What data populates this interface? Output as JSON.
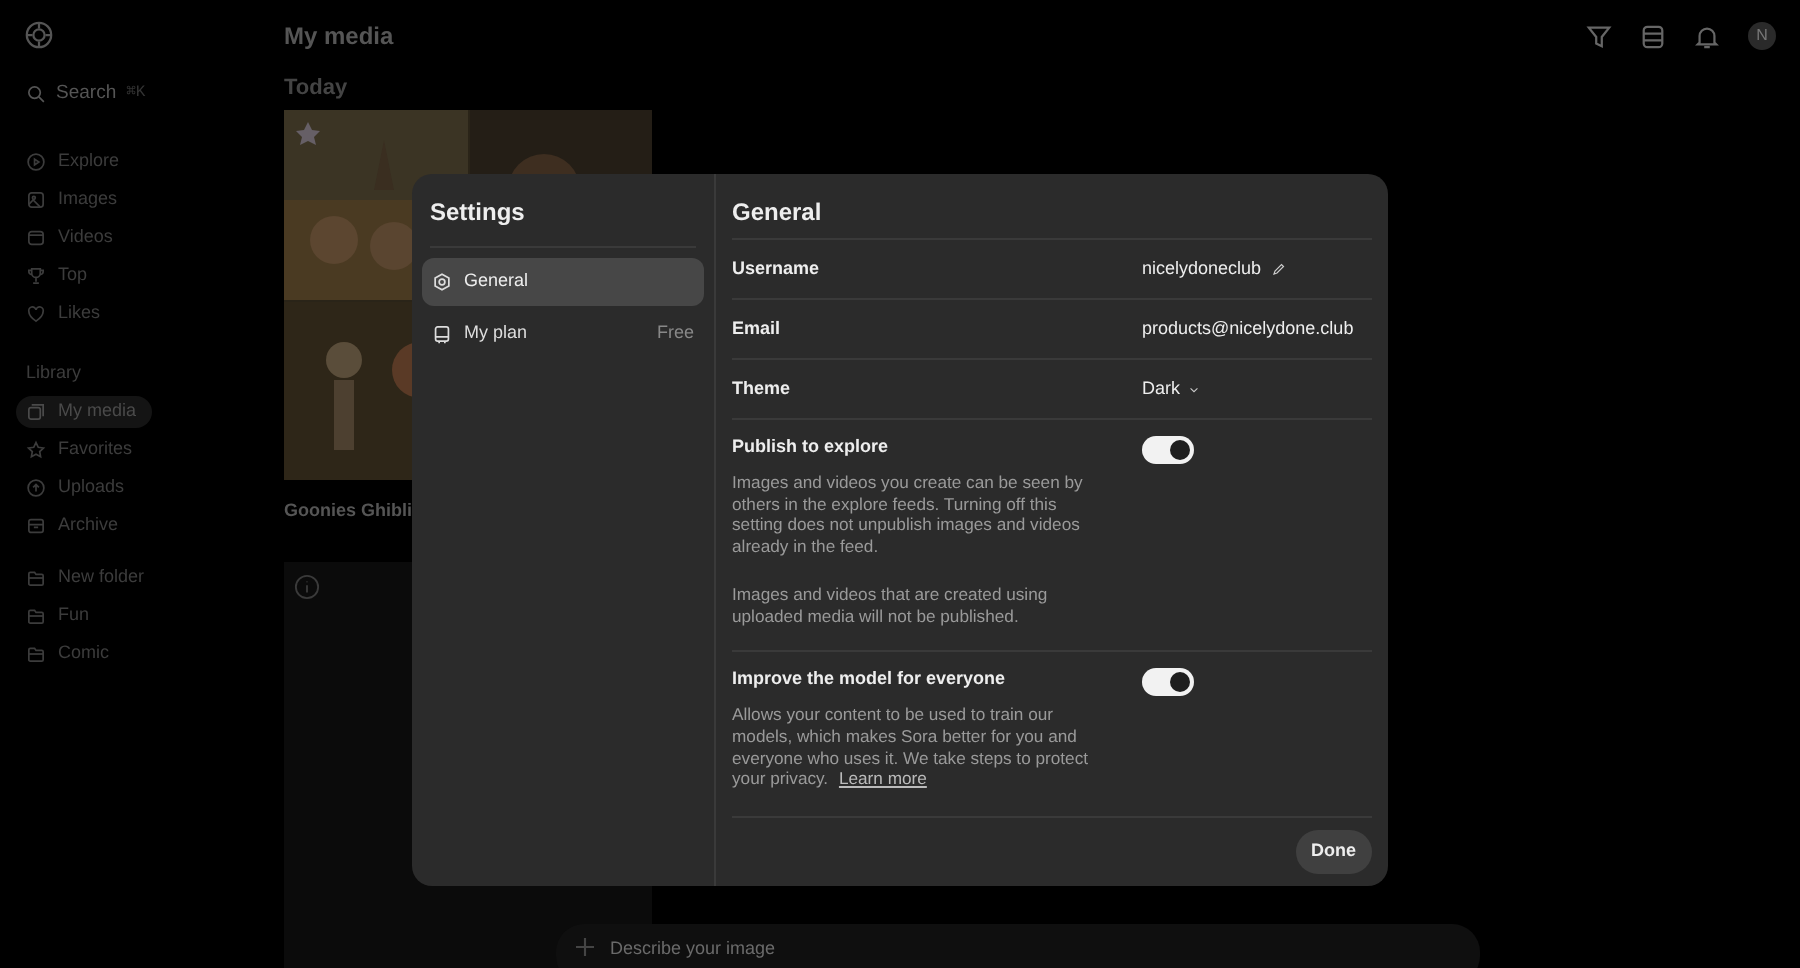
{
  "sidebar": {
    "search": {
      "label": "Search",
      "shortcut": "⌘K"
    },
    "nav": [
      {
        "label": "Explore"
      },
      {
        "label": "Images"
      },
      {
        "label": "Videos"
      },
      {
        "label": "Top"
      },
      {
        "label": "Likes"
      }
    ],
    "library_heading": "Library",
    "library": [
      {
        "label": "My media",
        "selected": true
      },
      {
        "label": "Favorites",
        "selected": false
      },
      {
        "label": "Uploads",
        "selected": false
      },
      {
        "label": "Archive",
        "selected": false
      }
    ],
    "folders": [
      {
        "label": "New folder"
      },
      {
        "label": "Fun"
      },
      {
        "label": "Comic"
      }
    ]
  },
  "header": {
    "title": "My media",
    "avatar": "N"
  },
  "main": {
    "section": "Today",
    "card_caption": "Goonies Ghibli",
    "prompt_placeholder": "Describe your image"
  },
  "settings": {
    "title": "Settings",
    "nav": [
      {
        "label": "General",
        "selected": true
      },
      {
        "label": "My plan",
        "badge": "Free",
        "selected": false
      }
    ],
    "panel_title": "General",
    "rows": [
      {
        "kind": "value",
        "label": "Username",
        "value": "nicelydoneclub",
        "editable": true
      },
      {
        "kind": "value",
        "label": "Email",
        "value": "products@nicelydone.club",
        "editable": false
      },
      {
        "kind": "select",
        "label": "Theme",
        "value": "Dark"
      },
      {
        "kind": "toggle",
        "label": "Publish to explore",
        "on": true,
        "paragraphs": [
          "Images and videos you create can be seen by others in the explore feeds. Turning off this setting does not unpublish images and videos already in the feed.",
          "Images and videos that are created using uploaded media will not be published."
        ]
      },
      {
        "kind": "toggle",
        "label": "Improve the model for everyone",
        "on": true,
        "paragraphs": [
          "Allows your content to be used to train our models, which makes Sora better for you and everyone who uses it. We take steps to protect your privacy."
        ],
        "link": "Learn more"
      }
    ],
    "done": "Done"
  }
}
